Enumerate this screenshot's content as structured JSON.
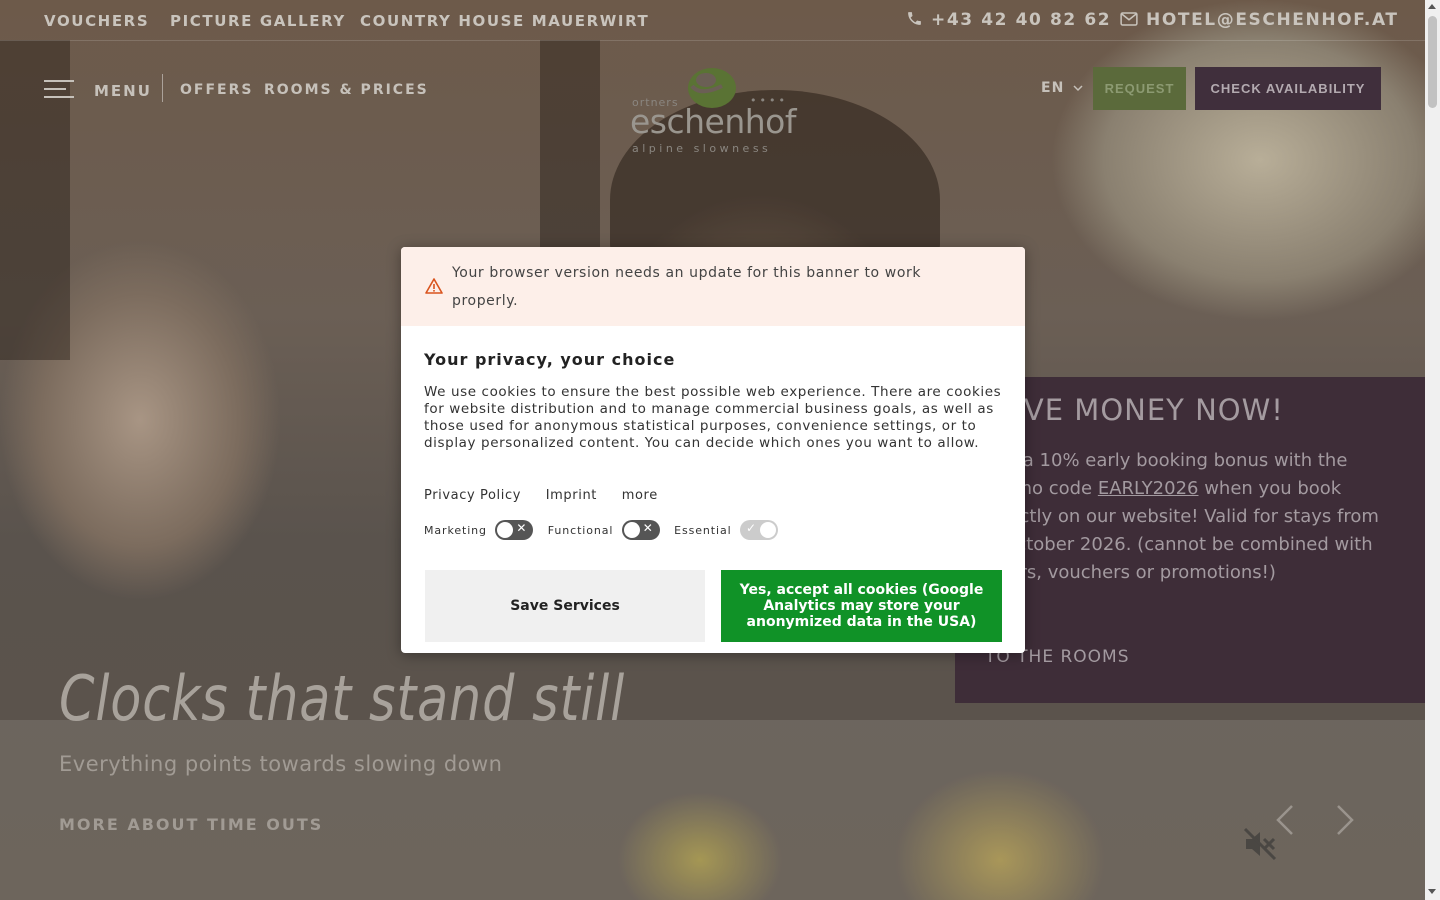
{
  "topbar": {
    "links": [
      "VOUCHERS",
      "PICTURE GALLERY",
      "COUNTRY HOUSE MAUERWIRT"
    ],
    "phone": "+43 42 40 82 62",
    "email": "HOTEL@ESCHENHOF.AT"
  },
  "nav": {
    "menu": "MENU",
    "offers": "OFFERS",
    "rooms": "ROOMS & PRICES",
    "lang": "EN",
    "request": "REQUEST",
    "check": "CHECK AVAILABILITY"
  },
  "logo": {
    "prefix": "ortners",
    "stars": "••••",
    "name": "eschenhof",
    "tagline": "alpine slowness"
  },
  "hero": {
    "title": "Clocks that stand still",
    "subtitle": "Everything points towards slowing down",
    "cta": "MORE ABOUT TIME OUTS"
  },
  "promo": {
    "title": "SAVE MONEY NOW!",
    "text_a": "Get a 10% early booking bonus with the promo code ",
    "code": "EARLY2026",
    "text_b": " when you book directly ",
    "text_c": "on our website",
    "text_d": "! Valid for stays from 1 October 2026. (cannot be combined with offers, vouchers or promotions!)",
    "link": "TO THE ROOMS"
  },
  "cookie": {
    "warning": "Your browser version needs an update for this banner to work properly.",
    "heading": "Your privacy, your choice",
    "description": "We use cookies to ensure the best possible web experience. There are cookies for website distribution and to manage commercial business goals, as well as those used for anonymous statistical purposes, convenience settings, or to display personalized content. You can decide which ones you want to allow.",
    "links": [
      "Privacy Policy",
      "Imprint",
      "more"
    ],
    "toggles": [
      {
        "label": "Marketing",
        "on": false
      },
      {
        "label": "Functional",
        "on": false
      },
      {
        "label": "Essential",
        "on": true
      }
    ],
    "save": "Save Services",
    "accept": "Yes, accept all cookies (Google Analytics may store your anonymized data in the USA)"
  },
  "colors": {
    "accept_green": "#109227",
    "warning_bg": "#fdefe9",
    "promo_bg": "#3e2d38",
    "request_bg": "#5b6a3b",
    "check_bg": "#402f3c"
  }
}
